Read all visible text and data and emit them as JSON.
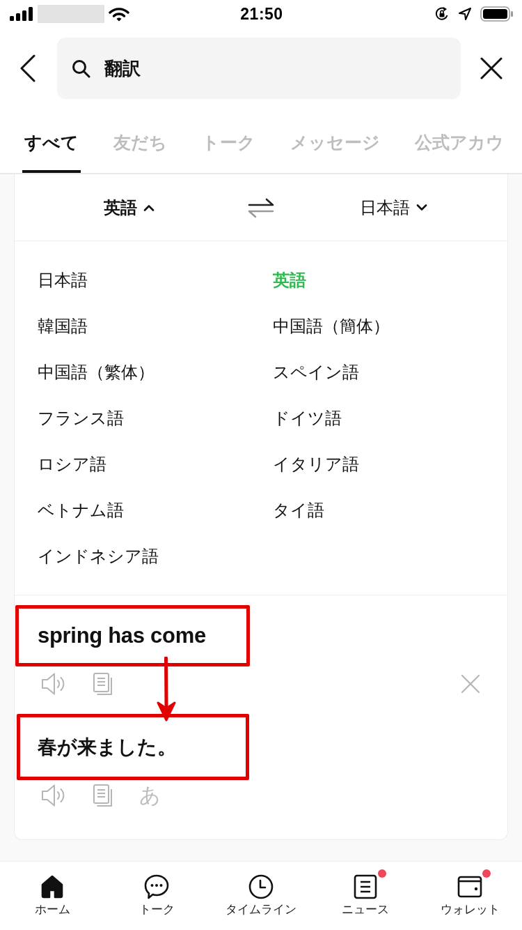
{
  "status_bar": {
    "time": "21:50"
  },
  "search": {
    "value": "翻訳"
  },
  "tabs": [
    {
      "label": "すべて",
      "selected": true
    },
    {
      "label": "友だち",
      "selected": false
    },
    {
      "label": "トーク",
      "selected": false
    },
    {
      "label": "メッセージ",
      "selected": false
    },
    {
      "label": "公式アカウ",
      "selected": false
    }
  ],
  "translator": {
    "source_language": {
      "label": "英語",
      "expanded": true
    },
    "target_language": {
      "label": "日本語",
      "expanded": false
    },
    "languages": [
      {
        "label": "日本語",
        "selected": false
      },
      {
        "label": "英語",
        "selected": true
      },
      {
        "label": "韓国語",
        "selected": false
      },
      {
        "label": "中国語（簡体）",
        "selected": false
      },
      {
        "label": "中国語（繁体）",
        "selected": false
      },
      {
        "label": "スペイン語",
        "selected": false
      },
      {
        "label": "フランス語",
        "selected": false
      },
      {
        "label": "ドイツ語",
        "selected": false
      },
      {
        "label": "ロシア語",
        "selected": false
      },
      {
        "label": "イタリア語",
        "selected": false
      },
      {
        "label": "ベトナム語",
        "selected": false
      },
      {
        "label": "タイ語",
        "selected": false
      },
      {
        "label": "インドネシア語",
        "selected": false
      }
    ],
    "source": {
      "text": "spring has come",
      "highlighted": true
    },
    "result": {
      "text": "春が来ました。",
      "highlighted": true,
      "reading_button": "あ"
    },
    "annotation_arrow": true
  },
  "bottom_nav": [
    {
      "kind": "home",
      "label": "ホーム",
      "selected": true,
      "badge": false
    },
    {
      "kind": "talk",
      "label": "トーク",
      "selected": false,
      "badge": false
    },
    {
      "kind": "timeline",
      "label": "タイムライン",
      "selected": false,
      "badge": false
    },
    {
      "kind": "news",
      "label": "ニュース",
      "selected": false,
      "badge": true
    },
    {
      "kind": "wallet",
      "label": "ウォレット",
      "selected": false,
      "badge": true
    }
  ]
}
